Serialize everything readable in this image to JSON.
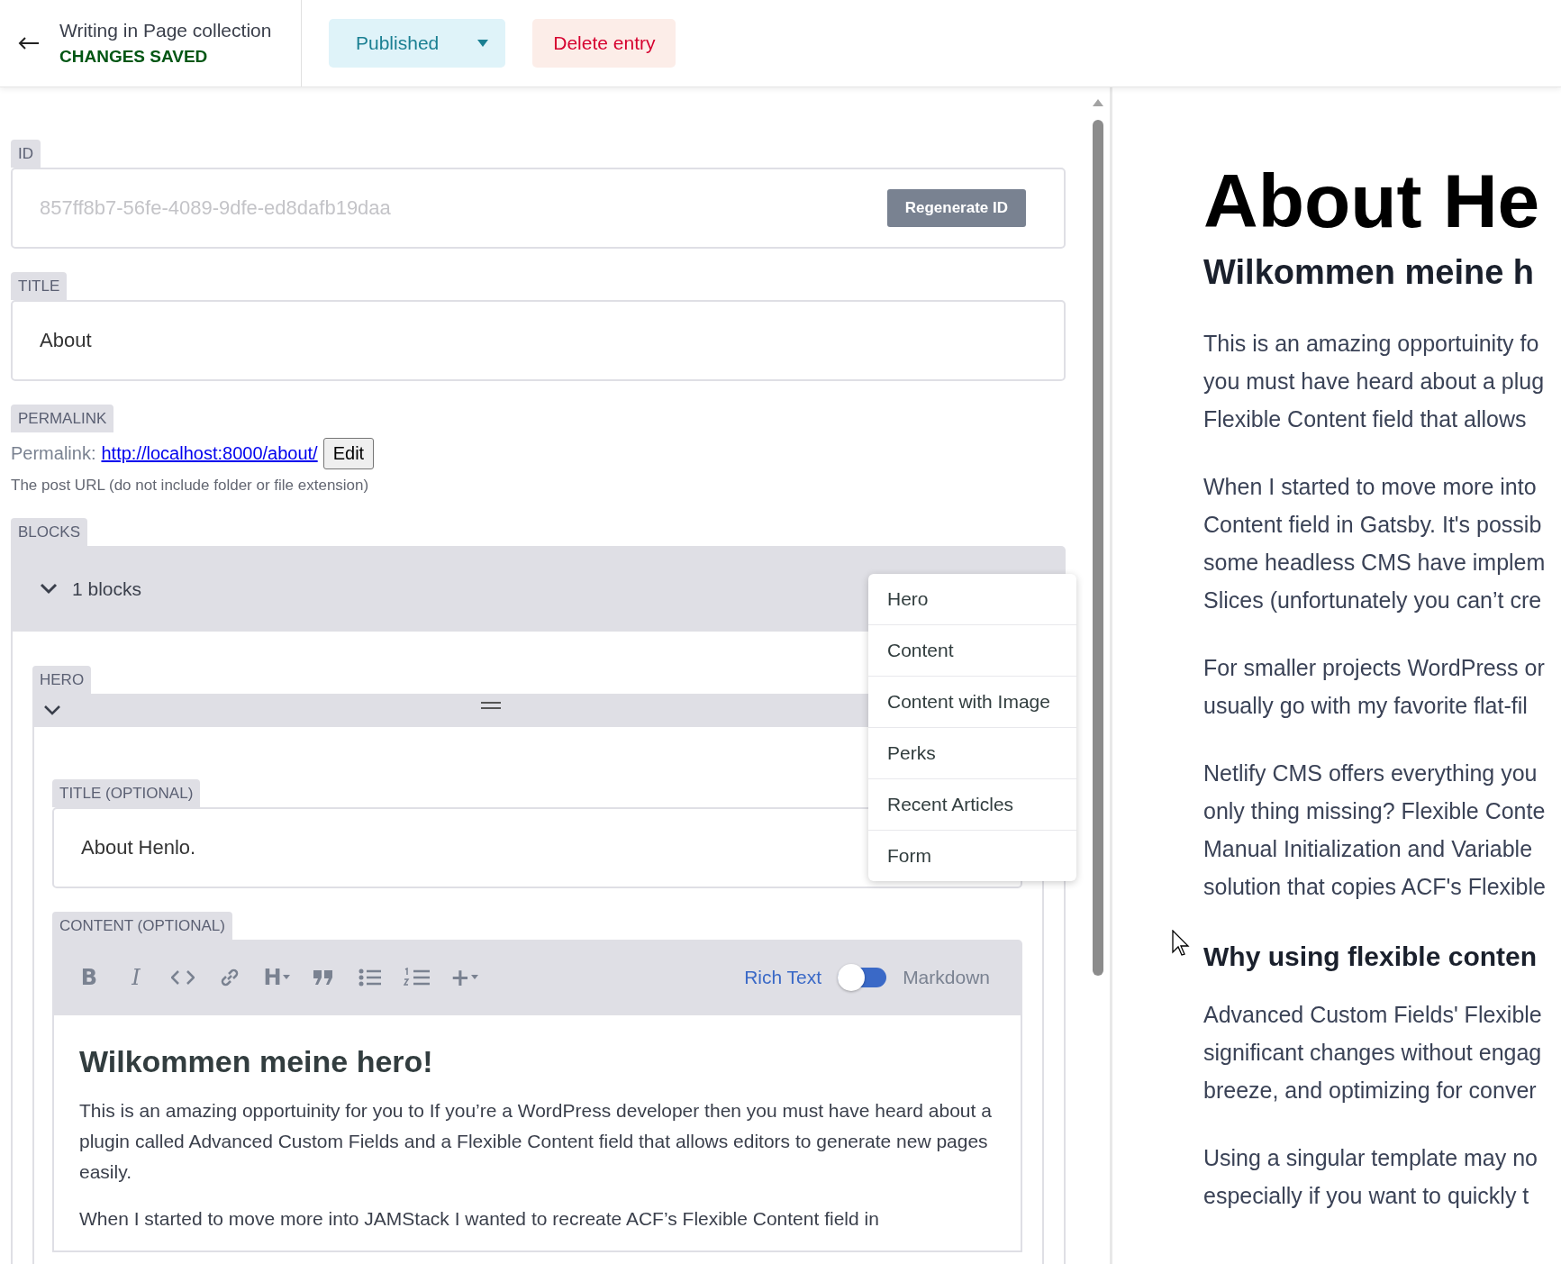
{
  "header": {
    "title": "Writing in Page collection",
    "status": "CHANGES SAVED",
    "publish_button": "Published",
    "delete_button": "Delete entry"
  },
  "id_field": {
    "label": "ID",
    "value": "857ff8b7-56fe-4089-9dfe-ed8dafb19daa",
    "disabled": true,
    "button": "Regenerate ID"
  },
  "title_field": {
    "label": "TITLE",
    "value": "About"
  },
  "permalink_field": {
    "label": "PERMALINK",
    "prefix": "Permalink:",
    "url": "http://localhost:8000/about/",
    "button": "Edit",
    "hint": "The post URL (do not include folder or file extension)"
  },
  "blocks_field": {
    "label": "BLOCKS",
    "summary": "1 blocks",
    "expanded": true,
    "add_menu": {
      "open": true,
      "items": [
        "Hero",
        "Content",
        "Content with Image",
        "Perks",
        "Recent Articles",
        "Form"
      ]
    },
    "blocks": [
      {
        "label": "HERO",
        "expanded": true,
        "title_field": {
          "label": "TITLE (OPTIONAL)",
          "value": "About Henlo."
        },
        "content_field": {
          "label": "CONTENT (OPTIONAL)",
          "toolbar": [
            {
              "kind": "bold",
              "glyph": "B"
            },
            {
              "kind": "italic",
              "glyph": "I"
            },
            {
              "kind": "code"
            },
            {
              "kind": "link"
            },
            {
              "kind": "heading",
              "glyph": "H"
            },
            {
              "kind": "quote"
            },
            {
              "kind": "bulleted-list"
            },
            {
              "kind": "numbered-list"
            },
            {
              "kind": "insert",
              "glyph": "+"
            }
          ],
          "mode_left": "Rich Text",
          "mode_right": "Markdown",
          "markdown": false,
          "heading": "Wilkommen meine hero!",
          "paragraphs": [
            "This is an amazing opportuinity for you to If you’re a WordPress developer then you must have heard about a plugin called Advanced Custom Fields and a Flexible Content field that allows editors to generate new pages easily.",
            "When I started to move more into JAMStack I wanted to recreate ACF’s Flexible Content field in"
          ]
        }
      }
    ]
  },
  "preview": [
    {
      "kind": "h1",
      "lines": [
        "About He"
      ]
    },
    {
      "kind": "h2",
      "lines": [
        "Wilkommen meine h"
      ]
    },
    {
      "kind": "p",
      "lines": [
        "This is an amazing opportuinity fo",
        "you must have heard about a plug",
        "Flexible Content field that allows"
      ]
    },
    {
      "kind": "p",
      "lines": [
        "When I started to move more into",
        "Content field in Gatsby. It's possib",
        "some headless CMS have implem",
        "Slices (unfortunately you can’t cre"
      ]
    },
    {
      "kind": "p",
      "lines": [
        "For smaller projects WordPress or",
        "usually go with my favorite flat-fil"
      ]
    },
    {
      "kind": "p",
      "lines": [
        "Netlify CMS offers everything you",
        "only thing missing? Flexible Conte",
        "Manual Initialization and Variable",
        "solution that copies ACF's Flexible"
      ]
    },
    {
      "kind": "h3",
      "lines": [
        "Why using flexible conten"
      ]
    },
    {
      "kind": "p",
      "lines": [
        "Advanced Custom Fields' Flexible",
        "significant changes without engag",
        "breeze, and optimizing for conver"
      ]
    },
    {
      "kind": "p",
      "lines": [
        "Using a singular template may no",
        "especially if you want to quickly t"
      ]
    }
  ]
}
